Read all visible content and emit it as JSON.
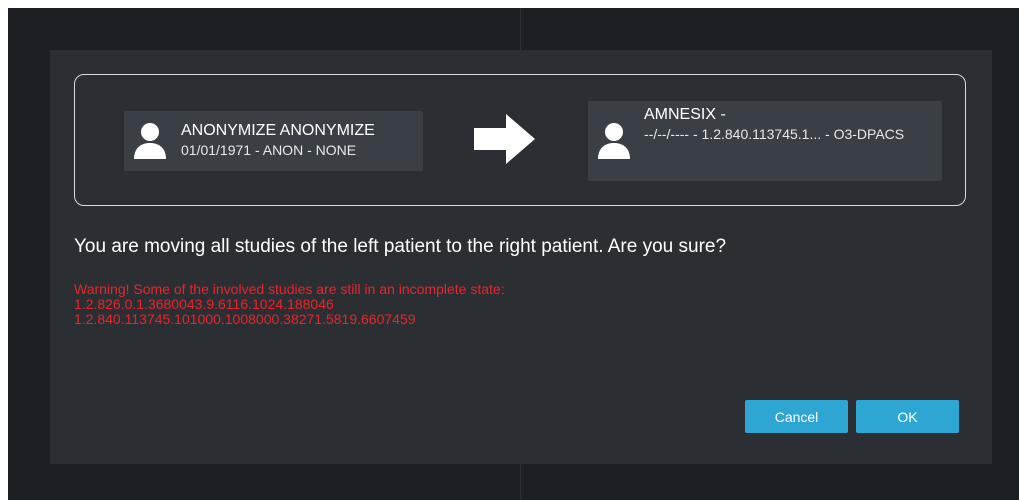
{
  "move_dialog": {
    "source_patient": {
      "name": "ANONYMIZE ANONYMIZE",
      "details": "01/01/1971 - ANON - NONE"
    },
    "target_patient": {
      "name": "AMNESIX -",
      "details": "--/--/---- - 1.2.840.113745.1... - O3-DPACS"
    },
    "arrow_icon": "right-arrow-icon",
    "avatar_icon": "user-avatar-icon",
    "question": "You are moving all studies of the left patient to the right patient. Are you sure?",
    "warning": {
      "heading": "Warning! Some of the involved studies are still in an incomplete state:",
      "studies": [
        "1.2.826.0.1.3680043.9.6116.1024.188046",
        "1.2.840.113745.101000.1008000.38271.5819.6607459"
      ]
    },
    "buttons": {
      "cancel_label": "Cancel",
      "ok_label": "OK"
    },
    "colors": {
      "dialog_bg": "#2b2e33",
      "card_bg": "#3a3f46",
      "warning": "#e8262b",
      "button": "#2ea6d4"
    }
  }
}
